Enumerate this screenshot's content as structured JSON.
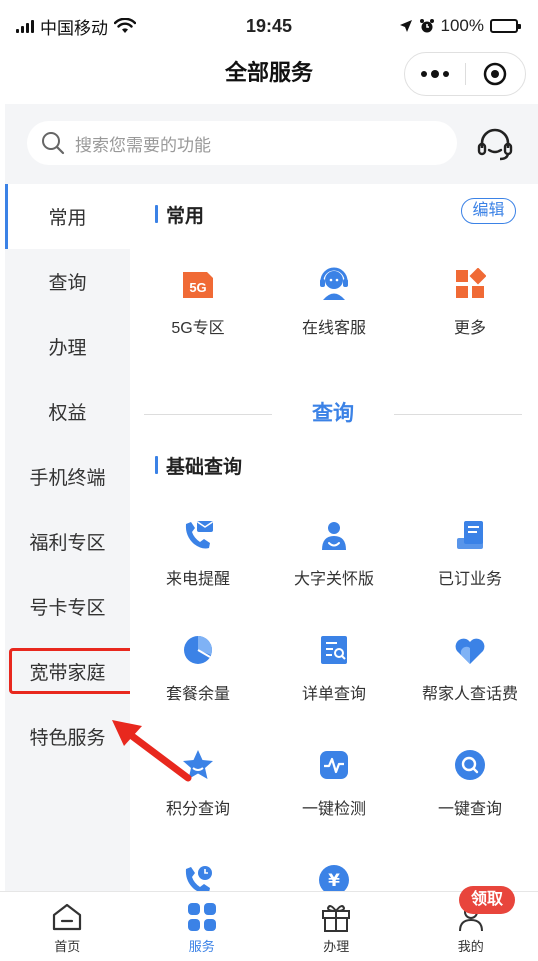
{
  "status_bar": {
    "carrier": "中国移动",
    "time": "19:45",
    "battery": "100%"
  },
  "nav": {
    "title": "全部服务"
  },
  "search": {
    "placeholder": "搜索您需要的功能"
  },
  "sidebar": {
    "items": [
      {
        "label": "常用"
      },
      {
        "label": "查询"
      },
      {
        "label": "办理"
      },
      {
        "label": "权益"
      },
      {
        "label": "手机终端"
      },
      {
        "label": "福利专区"
      },
      {
        "label": "号卡专区"
      },
      {
        "label": "宽带家庭"
      },
      {
        "label": "特色服务"
      }
    ]
  },
  "main": {
    "common": {
      "title": "常用",
      "edit_label": "编辑",
      "items": [
        {
          "label": "5G专区",
          "icon": "5g-icon",
          "color": "#f06a35",
          "badge": "5G"
        },
        {
          "label": "在线客服",
          "icon": "customer-service-icon",
          "color": "#3b82e6"
        },
        {
          "label": "更多",
          "icon": "more-grid-icon",
          "color": "#f06a35"
        }
      ]
    },
    "query_divider": "查询",
    "basic_query": {
      "title": "基础查询",
      "items": [
        {
          "label": "来电提醒",
          "icon": "call-reminder-icon"
        },
        {
          "label": "大字关怀版",
          "icon": "care-mode-icon"
        },
        {
          "label": "已订业务",
          "icon": "subscribed-business-icon"
        },
        {
          "label": "套餐余量",
          "icon": "plan-balance-icon"
        },
        {
          "label": "详单查询",
          "icon": "bill-detail-icon"
        },
        {
          "label": "帮家人查话费",
          "icon": "family-bill-icon"
        },
        {
          "label": "积分查询",
          "icon": "points-icon"
        },
        {
          "label": "一键检测",
          "icon": "one-click-check-icon"
        },
        {
          "label": "一键查询",
          "icon": "one-click-query-icon"
        },
        {
          "label": "",
          "icon": "call-history-icon"
        },
        {
          "label": "",
          "icon": "yuan-icon",
          "glyph": "¥"
        }
      ]
    }
  },
  "tabs": [
    {
      "label": "首页",
      "icon": "home-icon"
    },
    {
      "label": "服务",
      "icon": "service-grid-icon"
    },
    {
      "label": "办理",
      "icon": "gift-box-icon"
    },
    {
      "label": "我的",
      "icon": "profile-icon"
    }
  ],
  "claim_badge": "领取",
  "colors": {
    "accent": "#3b82e6",
    "orange": "#f06a35",
    "highlight": "#e8281e"
  }
}
